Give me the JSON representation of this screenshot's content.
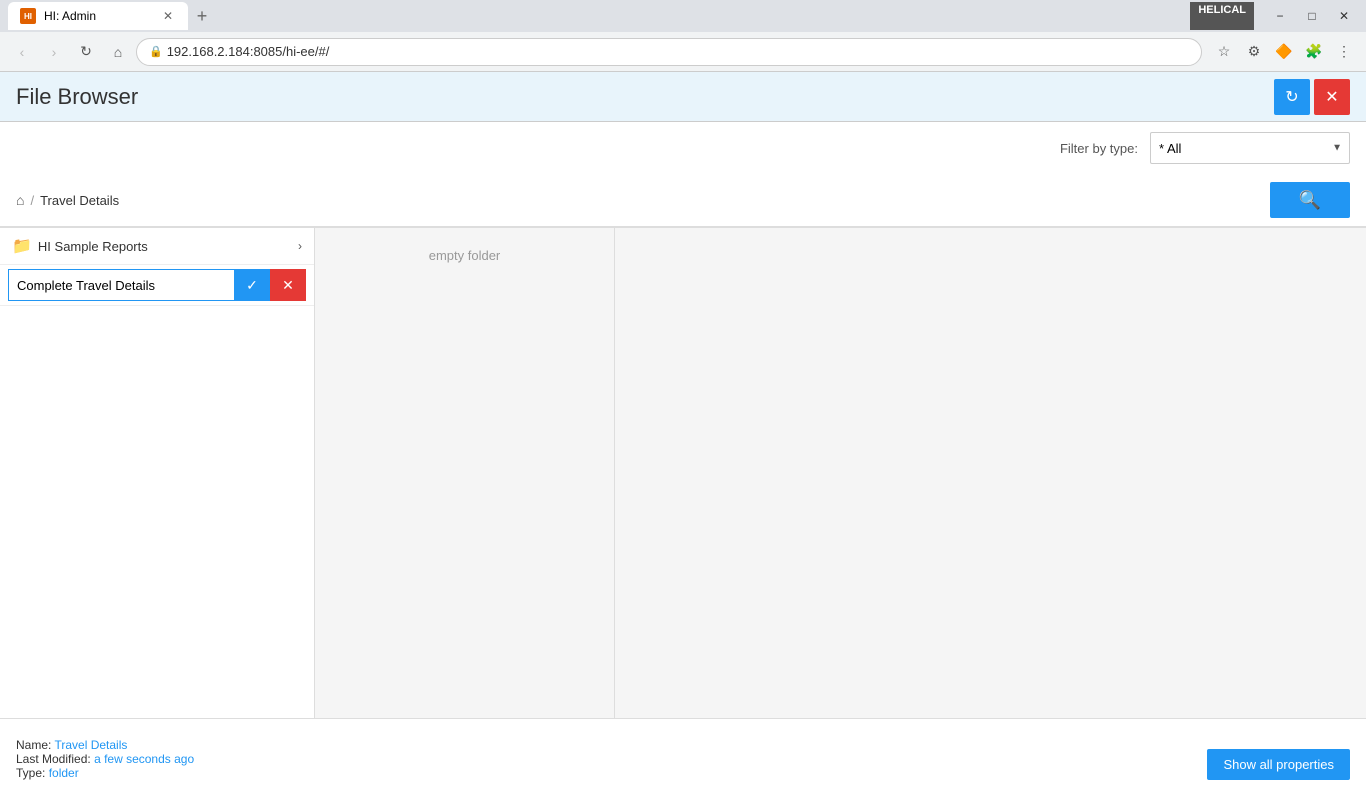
{
  "browser": {
    "tab_title": "HI: Admin",
    "tab_favicon": "HI",
    "address": "192.168.2.184:8085/hi-ee/#/",
    "new_tab_icon": "+",
    "helical_badge": "HELICAL"
  },
  "window_controls": {
    "minimize": "−",
    "maximize": "□",
    "close": "✕"
  },
  "header": {
    "title": "File Browser",
    "refresh_icon": "↻",
    "close_icon": "✕"
  },
  "filter": {
    "label": "Filter by type:",
    "selected": "* All"
  },
  "breadcrumb": {
    "home_icon": "⌂",
    "separator": "/",
    "current": "Travel Details",
    "search_icon": "🔍"
  },
  "left_panel": {
    "folder_icon": "📁",
    "folder_name": "HI Sample Reports",
    "arrow": "›",
    "rename_input_value": "Complete Travel Details",
    "confirm_icon": "✓",
    "cancel_icon": "✕"
  },
  "middle_panel": {
    "empty_text": "empty folder"
  },
  "status": {
    "name_label": "Name:",
    "name_value": "Travel Details",
    "modified_label": "Last Modified:",
    "modified_value": "a few seconds ago",
    "type_label": "Type:",
    "type_value": "folder",
    "show_props_label": "Show all properties"
  }
}
